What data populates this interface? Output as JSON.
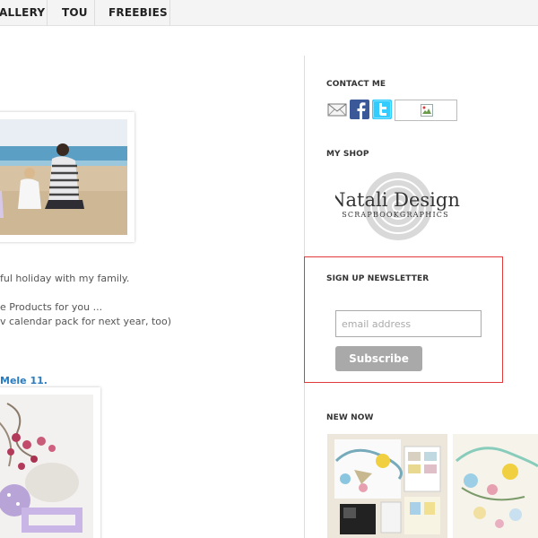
{
  "nav": {
    "items": [
      "ALLERY",
      "TOU",
      "FREEBIES"
    ]
  },
  "post": {
    "line1": "ful holiday with my family.",
    "line2": "e Products for you ...",
    "line3": "v calendar pack for next year, too)",
    "link": "Mele 11."
  },
  "sidebar": {
    "contact_title": "CONTACT ME",
    "contact_icons": [
      "mail-icon",
      "facebook-icon",
      "twitter-icon",
      "broken-image-icon"
    ],
    "shop_title": "MY SHOP",
    "shop_logo_text": "Natali Design",
    "shop_logo_subtext": "SCRAPBOOKGRAPHICS",
    "newsletter_title": "SIGN UP NEWSLETTER",
    "email_placeholder": "email address",
    "subscribe_label": "Subscribe",
    "new_now_title": "NEW NOW"
  },
  "colors": {
    "nav_bg": "#f4f4f4",
    "link": "#2a7bbf",
    "newsletter_border": "#e03a3a",
    "subscribe_bg": "#a9a9a9",
    "facebook": "#3b5998",
    "twitter": "#33ccff"
  }
}
